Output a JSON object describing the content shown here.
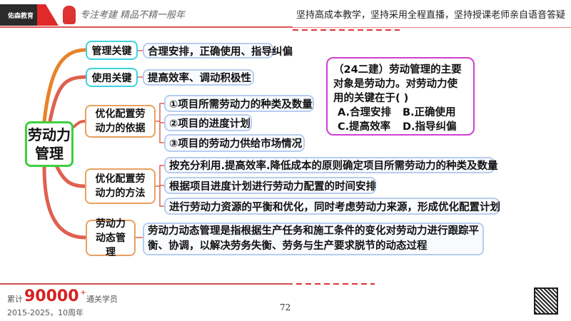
{
  "header": {
    "logo_text": "佑森教育",
    "handwriting": "专注考建 精品不精一般年",
    "slogan": "坚持高成本教学，坚持采用全程直播，坚持授课老师亲自语音答疑"
  },
  "mindmap": {
    "root": "劳动力管理",
    "branches": [
      {
        "label": "管理关键",
        "leaves": [
          "合理安排，正确使用、指导纠偏"
        ]
      },
      {
        "label": "使用关键",
        "leaves": [
          "提高效率、调动积极性"
        ]
      },
      {
        "label": "优化配置劳动力的依据",
        "leaves": [
          "①项目所需劳动力的种类及数量",
          "②项目的进度计划",
          "③项目的劳动力供给市场情况"
        ]
      },
      {
        "label": "优化配置劳动力的方法",
        "leaves": [
          "按充分利用.提高效率.降低成本的原则确定项目所需劳动力的种类及数量",
          "根据项目进度计划进行劳动力配置的时间安排",
          "进行劳动力资源的平衡和优化，同时考虑劳动力来源，形成优化配置计划"
        ]
      },
      {
        "label": "劳动力动态管理",
        "leaves": [
          "劳动力动态管理是指根据生产任务和施工条件的变化对劳动力进行跟踪平衡、协调，以解决劳务失衡、劳务与生产要求脱节的动态过程"
        ]
      }
    ]
  },
  "question": {
    "stem": "（24二建）劳动管理的主要对象是劳动力。对劳动力使用的关键在于(    )",
    "options": [
      "A.合理安排",
      "B.正确使用",
      "C.提高效率",
      "D.指导纠偏"
    ]
  },
  "footer": {
    "prefix": "累计",
    "count": "90000",
    "plus": "+",
    "suffix": "通关学员",
    "years": "2015-2025，10周年",
    "page": "72"
  },
  "colors": {
    "branch_orange": "#e8822a",
    "branch_red": "#e0604f",
    "root_border": "#3fd03f",
    "question_border": "#d03fd0"
  }
}
